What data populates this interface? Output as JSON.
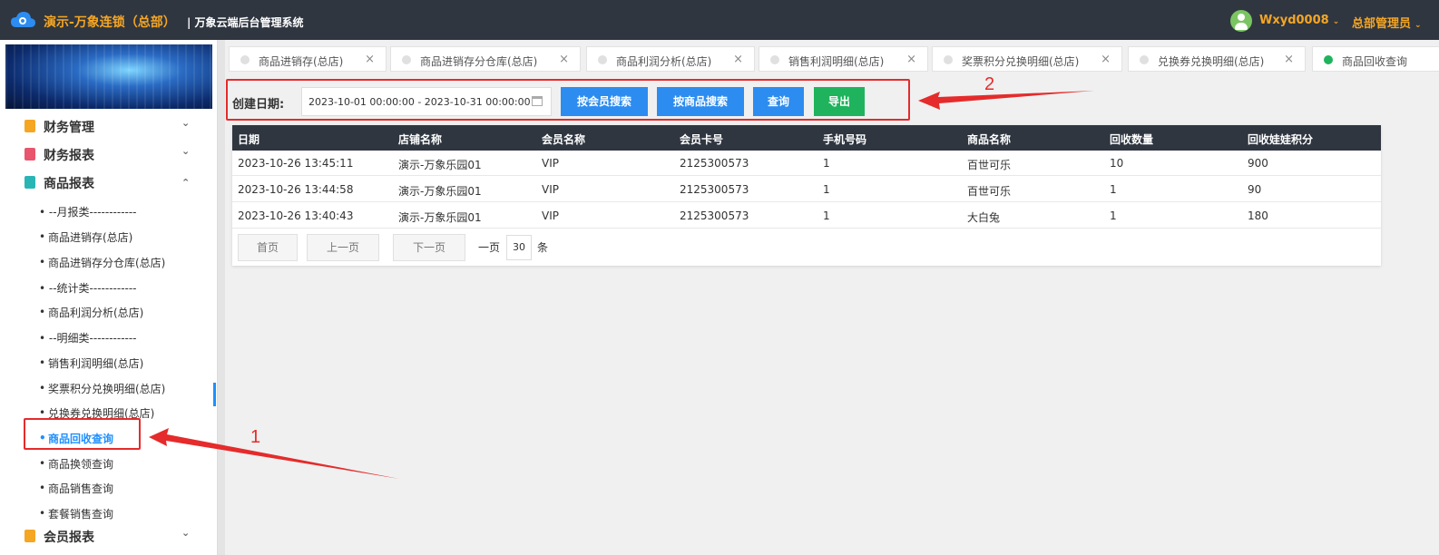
{
  "header": {
    "brand": "演示-万象连锁（总部）",
    "system_title": "| 万象云端后台管理系统",
    "username": "Wxyd0008",
    "role": "总部管理员"
  },
  "sidebar": {
    "groups": [
      {
        "label": "财务管理",
        "icon_color": "#f5a623"
      },
      {
        "label": "财务报表",
        "icon_color": "#e8556d"
      },
      {
        "label": "商品报表",
        "icon_color": "#2ab5b5"
      },
      {
        "label": "会员报表",
        "icon_color": "#f5a623"
      }
    ],
    "items": [
      "• --月报类------------",
      "商品进销存(总店)",
      "商品进销存分仓库(总店)",
      "• --统计类------------",
      "商品利润分析(总店)",
      "• --明细类------------",
      "销售利润明细(总店)",
      "奖票积分兑换明细(总店)",
      "兑换券兑换明细(总店)",
      "商品回收查询",
      "商品换领查询",
      "商品销售查询",
      "套餐销售查询"
    ]
  },
  "tabs": [
    {
      "label": "商品进销存(总店)"
    },
    {
      "label": "商品进销存分仓库(总店)"
    },
    {
      "label": "商品利润分析(总店)"
    },
    {
      "label": "销售利润明细(总店)"
    },
    {
      "label": "奖票积分兑换明细(总店)"
    },
    {
      "label": "兑换券兑换明细(总店)"
    },
    {
      "label": "商品回收查询"
    }
  ],
  "search": {
    "label": "创建日期:",
    "date_range": "2023-10-01 00:00:00 - 2023-10-31 00:00:00",
    "btn_member": "按会员搜索",
    "btn_product": "按商品搜索",
    "btn_query": "查询",
    "btn_export": "导出"
  },
  "table": {
    "columns": [
      "日期",
      "店铺名称",
      "会员名称",
      "会员卡号",
      "手机号码",
      "商品名称",
      "回收数量",
      "回收娃娃积分"
    ],
    "rows": [
      [
        "2023-10-26 13:45:11",
        "演示-万象乐园01",
        "VIP",
        "2125300573",
        "1",
        "百世可乐",
        "10",
        "900"
      ],
      [
        "2023-10-26 13:44:58",
        "演示-万象乐园01",
        "VIP",
        "2125300573",
        "1",
        "百世可乐",
        "1",
        "90"
      ],
      [
        "2023-10-26 13:40:43",
        "演示-万象乐园01",
        "VIP",
        "2125300573",
        "1",
        "大白兔",
        "1",
        "180"
      ]
    ]
  },
  "pager": {
    "first": "首页",
    "prev": "上一页",
    "next": "下一页",
    "per_page_prefix": "一页",
    "per_page": "30",
    "per_page_suffix": "条"
  },
  "annotations": {
    "label_1": "1",
    "label_2": "2",
    "color": "#e52b2b"
  }
}
